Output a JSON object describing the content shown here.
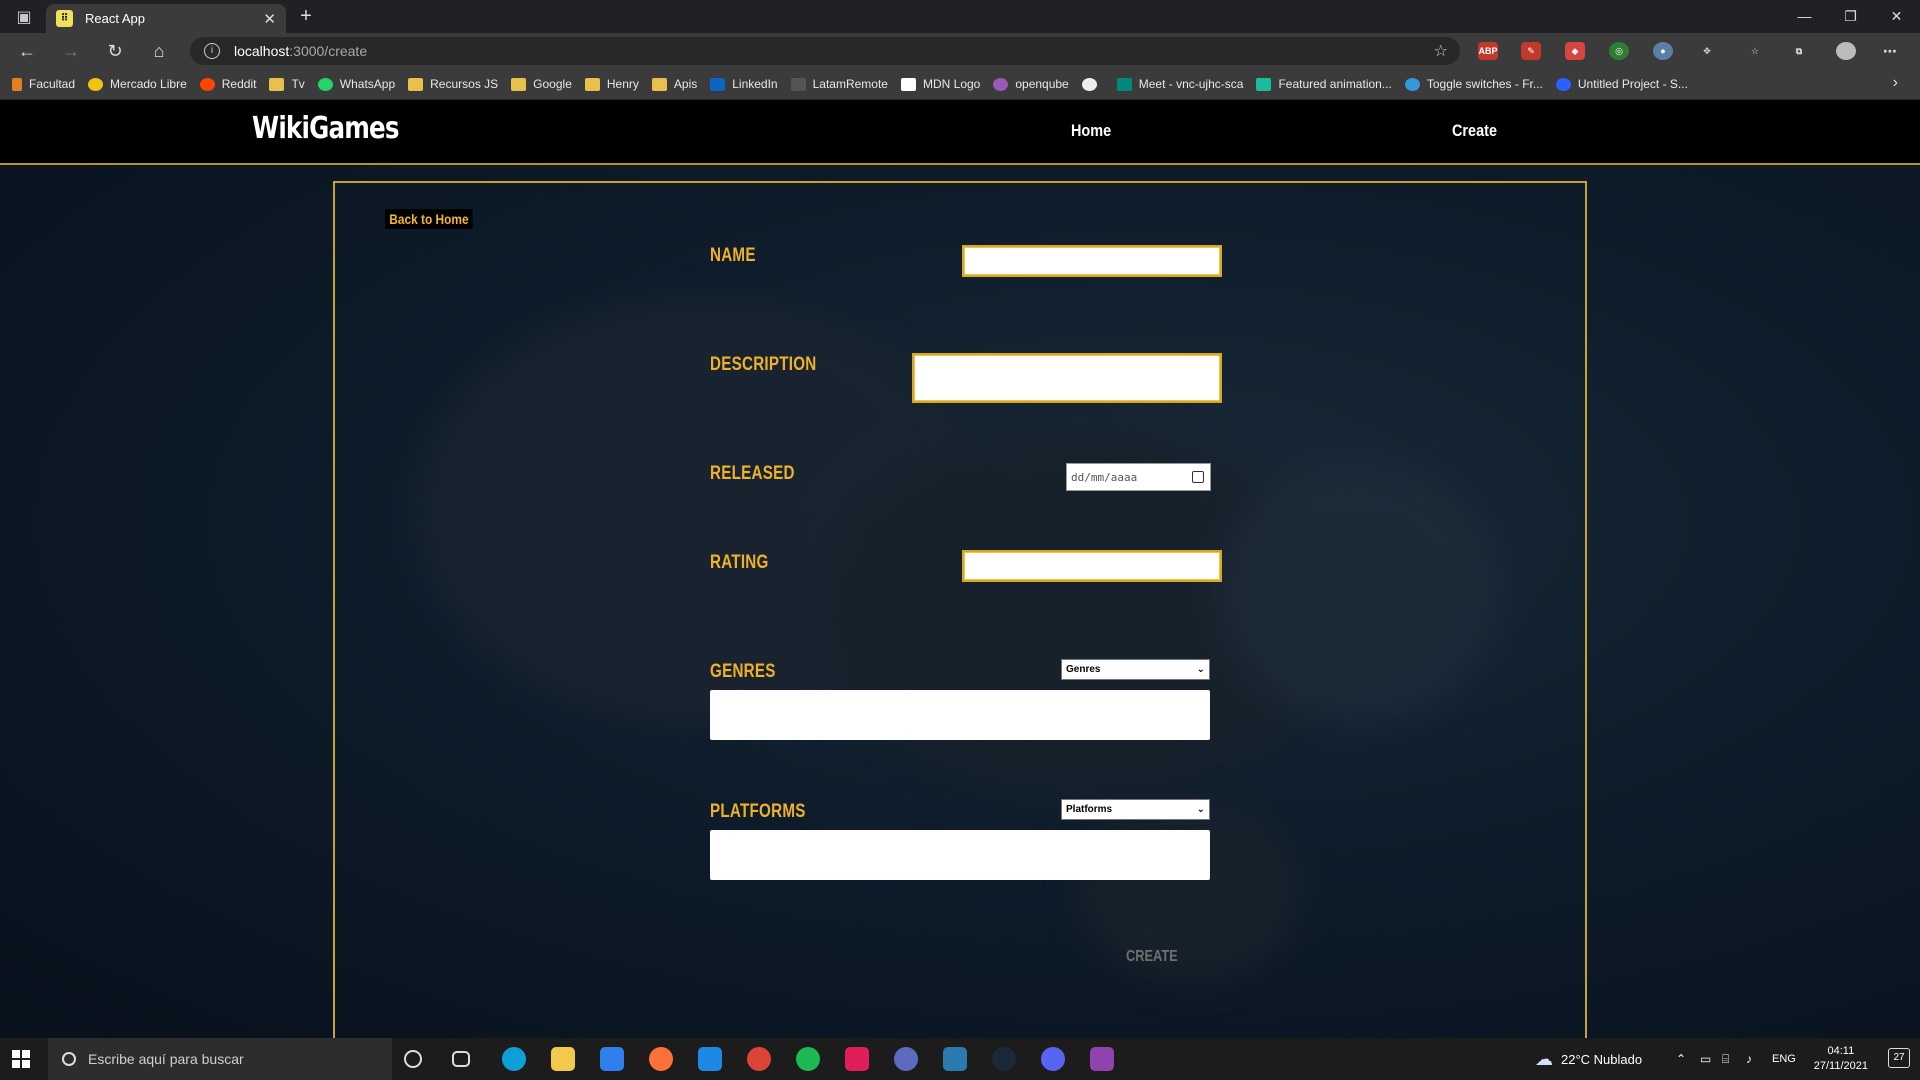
{
  "browser": {
    "tab_title": "React App",
    "tab_favicon_icon": "react-app-favicon",
    "url_host": "localhost",
    "url_path": ":3000/create",
    "bookmarks": [
      {
        "label": "Facultad"
      },
      {
        "label": "Mercado Libre"
      },
      {
        "label": "Reddit"
      },
      {
        "label": "Tv"
      },
      {
        "label": "WhatsApp"
      },
      {
        "label": "Recursos JS"
      },
      {
        "label": "Google"
      },
      {
        "label": "Henry"
      },
      {
        "label": "Apis"
      },
      {
        "label": "LinkedIn"
      },
      {
        "label": "LatamRemote"
      },
      {
        "label": "MDN Logo"
      },
      {
        "label": "openqube"
      },
      {
        "label": ""
      },
      {
        "label": "Meet - vnc-ujhc-sca"
      },
      {
        "label": "Featured animation..."
      },
      {
        "label": "Toggle switches - Fr..."
      },
      {
        "label": "Untitled Project - S..."
      }
    ]
  },
  "app": {
    "brand": "WikiGames",
    "nav": {
      "home": "Home",
      "create": "Create"
    },
    "back_label": "Back to Home",
    "form": {
      "name_label": "NAME",
      "description_label": "DESCRIPTION",
      "released_label": "RELEASED",
      "released_placeholder": "dd/mm/aaaa",
      "rating_label": "RATING",
      "genres_label": "GENRES",
      "genres_select": "Genres",
      "platforms_label": "PLATFORMS",
      "platforms_select": "Platforms",
      "create_label": "CREATE"
    },
    "colors": {
      "accent": "#f0b12a",
      "border": "#c9a227",
      "navbar": "#000000"
    }
  },
  "taskbar": {
    "search_placeholder": "Escribe aquí para buscar",
    "weather": "22°C  Nublado",
    "language": "ENG",
    "time": "04:11",
    "date": "27/11/2021",
    "notifications": "27"
  }
}
